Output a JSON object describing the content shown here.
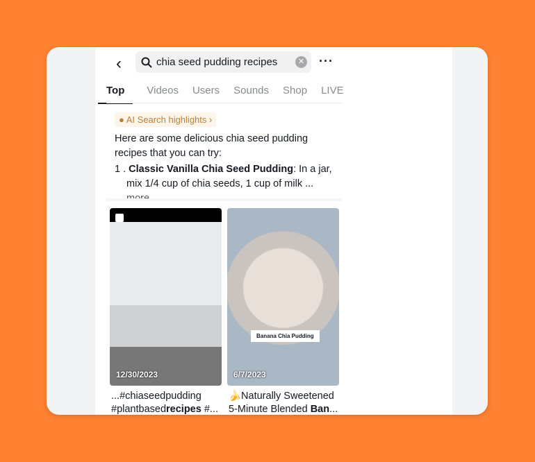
{
  "search": {
    "query": "chia seed pudding recipes"
  },
  "tabs": [
    "Top",
    "Videos",
    "Users",
    "Sounds",
    "Shop",
    "LIVE"
  ],
  "ai": {
    "label": "AI Search highlights",
    "intro": "Here are some delicious chia seed pudding recipes that you can try:",
    "num": "1 . ",
    "title": "Classic Vanilla Chia Seed Pudding",
    "text": ": In a jar, mix 1/4 cup of chia seeds, 1 cup of milk ... ",
    "more": "more"
  },
  "results": [
    {
      "date": "12/30/2023",
      "caption_pre": "...#chiaseedpudding #plantbased",
      "caption_bold": "recipes",
      "caption_post": " #..."
    },
    {
      "date": "6/7/2023",
      "overlay": "Banana Chia Pudding",
      "caption_pre": "🍌Naturally Sweetened 5-Minute Blended ",
      "caption_bold": "Ban",
      "caption_post": "..."
    }
  ]
}
